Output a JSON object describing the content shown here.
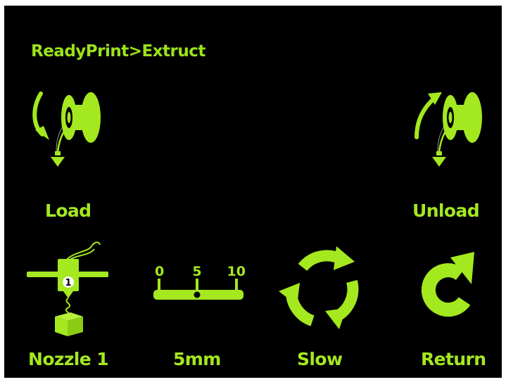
{
  "title": "ReadyPrint>Extruct",
  "colors": {
    "accent": "#a4e81f",
    "background": "#000000",
    "nozzle_badge": "#ffffff"
  },
  "buttons": {
    "load": {
      "label": "Load",
      "icon": "filament-load-icon"
    },
    "unload": {
      "label": "Unload",
      "icon": "filament-unload-icon"
    },
    "nozzle": {
      "label": "Nozzle 1",
      "icon": "nozzle-icon",
      "badge": "1"
    },
    "distance": {
      "label": "5mm",
      "icon": "distance-scale-icon",
      "scale": [
        "0",
        "5",
        "10"
      ]
    },
    "speed": {
      "label": "Slow",
      "icon": "speed-cycle-icon"
    },
    "return": {
      "label": "Return",
      "icon": "return-arrow-icon"
    }
  }
}
